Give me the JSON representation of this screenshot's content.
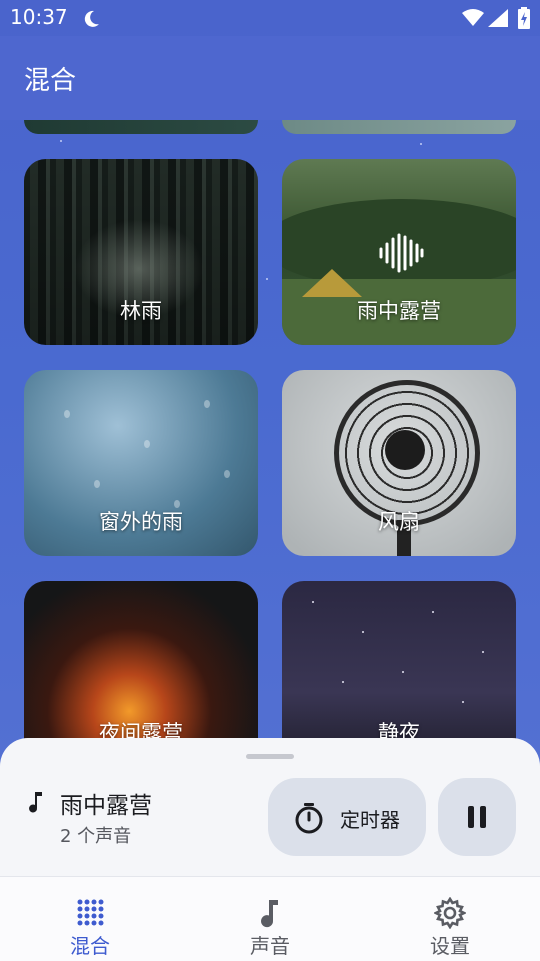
{
  "status_bar": {
    "time": "10:37"
  },
  "app_bar": {
    "title": "混合"
  },
  "cards": [
    {
      "label": "林雨"
    },
    {
      "label": "雨中露营",
      "playing": true
    },
    {
      "label": "窗外的雨"
    },
    {
      "label": "风扇"
    },
    {
      "label": "夜间露营"
    },
    {
      "label": "静夜"
    }
  ],
  "now_playing": {
    "title": "雨中露营",
    "subtitle": "2 个声音",
    "timer_label": "定时器"
  },
  "nav": {
    "items": [
      {
        "label": "混合",
        "icon": "mix-dots-icon",
        "active": true
      },
      {
        "label": "声音",
        "icon": "music-note-icon",
        "active": false
      },
      {
        "label": "设置",
        "icon": "gear-icon",
        "active": false
      }
    ]
  },
  "colors": {
    "background": "#4a64cc",
    "accent": "#3e5bcf",
    "sheet": "#f5f6f9",
    "button": "#dbe0ea"
  }
}
